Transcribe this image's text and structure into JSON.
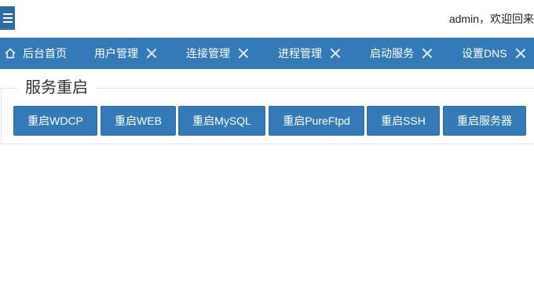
{
  "header": {
    "menu_icon": "hamburger-menu-icon",
    "welcome_text": "admin，欢迎回来"
  },
  "tabs": [
    {
      "label": "后台首页",
      "icon": "home-icon",
      "closable": false
    },
    {
      "label": "用户管理",
      "closable": true
    },
    {
      "label": "连接管理",
      "closable": true
    },
    {
      "label": "进程管理",
      "closable": true
    },
    {
      "label": "启动服务",
      "closable": true
    },
    {
      "label": "设置DNS",
      "closable": true
    }
  ],
  "panel": {
    "legend": "服务重启",
    "buttons": [
      {
        "label": "重启WDCP"
      },
      {
        "label": "重启WEB"
      },
      {
        "label": "重启MySQL"
      },
      {
        "label": "重启PureFtpd"
      },
      {
        "label": "重启SSH"
      },
      {
        "label": "重启服务器"
      }
    ]
  },
  "colors": {
    "primary": "#337ab7",
    "primary_border": "#2e6da4",
    "text": "#333333"
  }
}
